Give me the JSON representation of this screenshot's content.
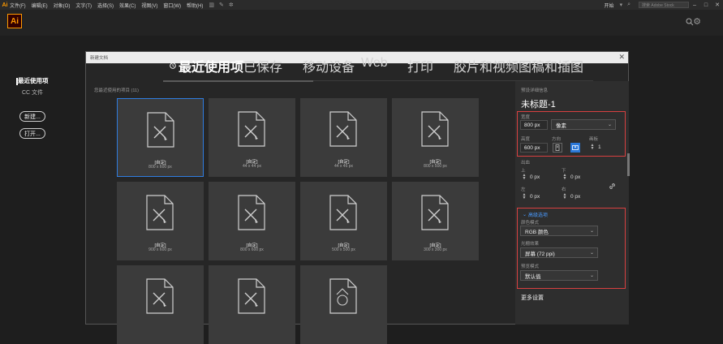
{
  "menubar": {
    "logo": "Ai",
    "items": [
      "文件(F)",
      "编辑(E)",
      "对象(O)",
      "文字(T)",
      "选择(S)",
      "效果(C)",
      "视图(V)",
      "窗口(W)",
      "帮助(H)"
    ],
    "workspace": "开始",
    "search_placeholder": "搜索 Adobe Stock"
  },
  "app": {
    "logo": "Ai"
  },
  "sidebar": {
    "title": "最近使用项",
    "sub": "CC 文件",
    "new_button": "新建...",
    "open_button": "打开..."
  },
  "dialog": {
    "title": "新建文档",
    "tabs": [
      {
        "label": "最近使用项",
        "active": true
      },
      {
        "label": "已保存",
        "active": false
      },
      {
        "label": "移动设备",
        "active": false
      },
      {
        "label": "Web",
        "active": false
      },
      {
        "label": "打印",
        "active": false
      },
      {
        "label": "胶片和视频",
        "active": false
      },
      {
        "label": "图稿和插图",
        "active": false
      }
    ],
    "section_label": "您最近使用的项目 (11)",
    "presets": [
      {
        "name": "[自定]",
        "size": "800 x 600 px",
        "selected": true,
        "icon": "doc-brush-icon"
      },
      {
        "name": "[自定]",
        "size": "44 x 44 px",
        "selected": false,
        "icon": "doc-brush-icon"
      },
      {
        "name": "[自定]",
        "size": "44 x 46 px",
        "selected": false,
        "icon": "doc-brush-icon"
      },
      {
        "name": "[自定]",
        "size": "800 x 500 px",
        "selected": false,
        "icon": "doc-brush-icon"
      },
      {
        "name": "[自定]",
        "size": "900 x 600 px",
        "selected": false,
        "icon": "doc-brush-icon"
      },
      {
        "name": "[自定]",
        "size": "800 x 600 px",
        "selected": false,
        "icon": "doc-brush-icon"
      },
      {
        "name": "[自定]",
        "size": "500 x 500 px",
        "selected": false,
        "icon": "doc-brush-icon"
      },
      {
        "name": "[自定]",
        "size": "300 x 300 px",
        "selected": false,
        "icon": "doc-brush-icon"
      },
      {
        "name": "",
        "size": "",
        "selected": false,
        "icon": "doc-brush-icon"
      },
      {
        "name": "",
        "size": "",
        "selected": false,
        "icon": "doc-brush-icon"
      },
      {
        "name": "",
        "size": "",
        "selected": false,
        "icon": "doc-shapes-icon"
      }
    ]
  },
  "details": {
    "header": "预设详细信息",
    "doc_title": "未标题-1",
    "width_label": "宽度",
    "width_value": "800 px",
    "unit_value": "像素",
    "height_label": "高度",
    "height_value": "600 px",
    "orientation_label": "方向",
    "artboards_label": "画板",
    "artboards_value": "1",
    "bleed_label": "出血",
    "bleed_top_label": "上",
    "bleed_top": "0 px",
    "bleed_bottom_label": "下",
    "bleed_bottom": "0 px",
    "bleed_left_label": "左",
    "bleed_left": "0 px",
    "bleed_right_label": "右",
    "bleed_right": "0 px",
    "advanced_label": "高级选项",
    "color_mode_label": "颜色模式",
    "color_mode_value": "RGB 颜色",
    "raster_label": "光栅效果",
    "raster_value": "屏幕 (72 ppi)",
    "preview_label": "预览模式",
    "preview_value": "默认值",
    "more_settings": "更多设置"
  },
  "colors": {
    "accent": "#2f7de1",
    "highlight_box": "#d84040",
    "logo": "#ff9a00"
  }
}
